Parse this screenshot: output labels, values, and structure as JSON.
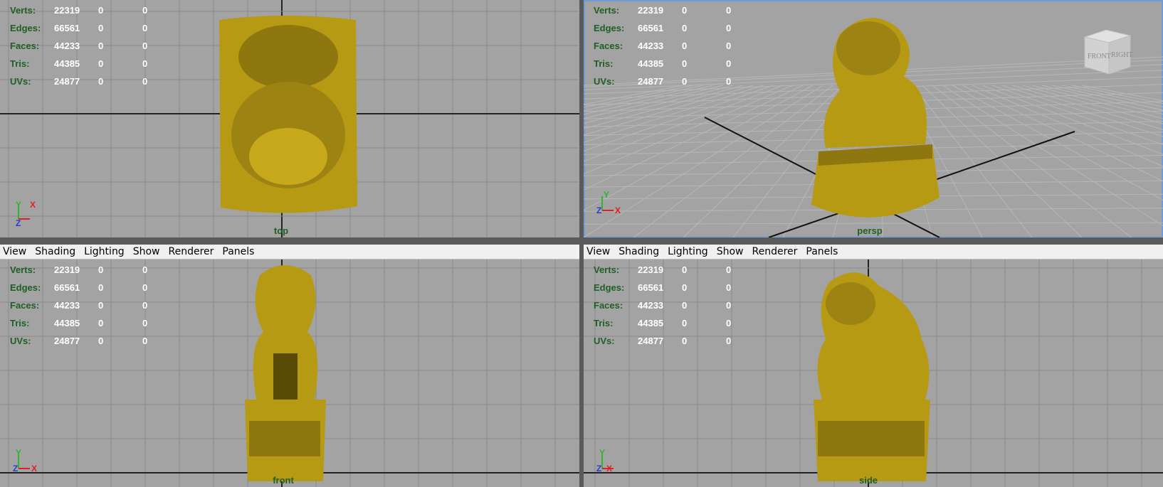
{
  "hud": {
    "labels": [
      "Verts:",
      "Edges:",
      "Faces:",
      "Tris:",
      "UVs:"
    ],
    "values": [
      "22319",
      "66561",
      "44233",
      "44385",
      "24877"
    ],
    "zeros": [
      "0",
      "0"
    ]
  },
  "menu": [
    "View",
    "Shading",
    "Lighting",
    "Show",
    "Renderer",
    "Panels"
  ],
  "viewports": {
    "top": {
      "label": "top"
    },
    "persp": {
      "label": "persp"
    },
    "front": {
      "label": "front"
    },
    "side": {
      "label": "side"
    }
  },
  "viewcube": {
    "front": "FRONT",
    "right": "RIGHT"
  },
  "axes": {
    "x": "X",
    "y": "Y",
    "z": "Z"
  },
  "colors": {
    "viewport_bg": "#a3a3a3",
    "grid": "#8a8a8a",
    "hud_label": "#1f5f24",
    "gold": "#b79a14",
    "active_border": "#6f9bd6"
  }
}
